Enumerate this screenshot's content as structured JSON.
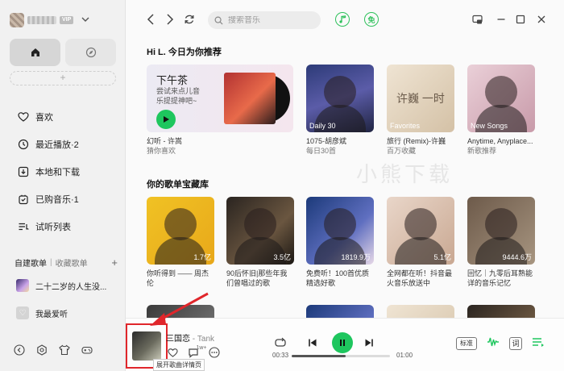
{
  "sidebar": {
    "user": {
      "vip_badge": "VIP"
    },
    "add_label": "+",
    "items": [
      {
        "label": "喜欢",
        "icon": "heart-icon"
      },
      {
        "label": "最近播放·2",
        "icon": "clock-icon"
      },
      {
        "label": "本地和下载",
        "icon": "download-icon"
      },
      {
        "label": "已购音乐·1",
        "icon": "purchase-icon"
      },
      {
        "label": "试听列表",
        "icon": "list-icon"
      }
    ],
    "playlists_tabs": {
      "created": "自建歌单",
      "collected": "收藏歌单",
      "add": "+"
    },
    "playlists": [
      {
        "label": "二十二岁的人生没..."
      },
      {
        "label": "我最爱听",
        "glyph": "♡"
      }
    ]
  },
  "topbar": {
    "search_placeholder": "搜索音乐",
    "free_label": "免"
  },
  "recommend": {
    "title": "Hi L. 今日为你推荐",
    "banner": {
      "title": "下午茶",
      "subtitle": "尝试来点儿音乐提提神吧~",
      "cap1": "幻听 - 许嵩",
      "cap2": "猜你喜欢"
    },
    "cards": [
      {
        "tag": "Daily 30",
        "cap1": "1075-胡彦斌",
        "cap2": "每日30首"
      },
      {
        "tag": "Favorites",
        "cap1": "旅行 (Remix)-许巍",
        "cap2": "百万收藏",
        "art_text": "许巍  一时"
      },
      {
        "tag": "New Songs",
        "cap1": "Anytime, Anyplace...",
        "cap2": "新歌推荐"
      }
    ]
  },
  "library": {
    "title": "你的歌单宝藏库",
    "cards": [
      {
        "count": "1.7亿",
        "caption": "你听得到 —— 周杰伦"
      },
      {
        "count": "3.5亿",
        "caption": "90后怀旧|那些年我们曾唱过的歌"
      },
      {
        "count": "1819.9万",
        "caption": "免费听！100首优质精选好歌"
      },
      {
        "count": "5.1亿",
        "caption": "全网都在听！抖音最火音乐放送中"
      },
      {
        "count": "9444.6万",
        "caption": "回忆｜九零后耳熟能详的音乐记忆"
      }
    ]
  },
  "watermark": "小熊下载",
  "player": {
    "title": "三国恋",
    "artist": "- Tank",
    "comment_count": "1w+",
    "tooltip": "展开歌曲详情页",
    "time_current": "00:33",
    "time_total": "01:00",
    "progress_fraction": 0.55,
    "quality_label": "标准",
    "lyrics_label": "词"
  },
  "colors": {
    "accent": "#1ec65e",
    "annotation": "#e0262b"
  }
}
